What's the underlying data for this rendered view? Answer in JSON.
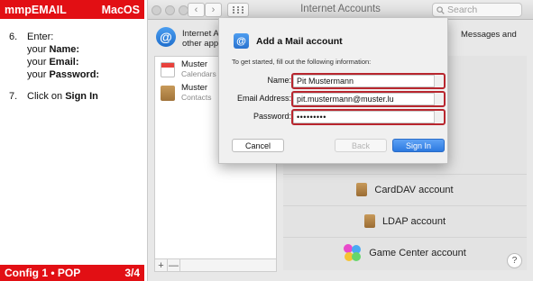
{
  "guide": {
    "header_left": "mmpEMAIL",
    "header_right": "MacOS",
    "step6": {
      "number": "6.",
      "intro": "Enter:",
      "line1_prefix": "your ",
      "line1_bold": "Name:",
      "line2_prefix": "your ",
      "line2_bold": "Email:",
      "line3_prefix": "your ",
      "line3_bold": "Password:"
    },
    "step7": {
      "number": "7.",
      "prefix": "Click on ",
      "bold": "Sign In"
    },
    "footer_left": "Config 1 • POP",
    "footer_right": "3/4"
  },
  "window": {
    "title": "Internet Accounts",
    "search_placeholder": "Search",
    "intro_line1": "Internet Ac",
    "intro_line2": "other apps",
    "intro_line3": "Messages and",
    "accounts": [
      {
        "name": "Muster",
        "type": "Calendars",
        "icon": "calendar-icon"
      },
      {
        "name": "Muster",
        "type": "Contacts",
        "icon": "contacts-icon"
      }
    ],
    "list_add": "+",
    "list_remove": "—",
    "providers": [
      {
        "label": "CardDAV account",
        "icon": "contacts-icon"
      },
      {
        "label": "LDAP account",
        "icon": "contacts-icon"
      },
      {
        "label": "Game Center account",
        "icon": "game-center-icon"
      }
    ],
    "help": "?"
  },
  "dialog": {
    "title": "Add a Mail account",
    "hint": "To get started, fill out the following information:",
    "name_label": "Name:",
    "name_value": "Pit Mustermann",
    "email_label": "Email Address:",
    "email_value": "pit.mustermann@muster.lu",
    "password_label": "Password:",
    "password_value": "•••••••••",
    "cancel": "Cancel",
    "back": "Back",
    "sign_in": "Sign In"
  },
  "colors": {
    "guide_red": "#e20f14",
    "highlight": "#b8262e",
    "primary_button": "#2c79e0"
  }
}
